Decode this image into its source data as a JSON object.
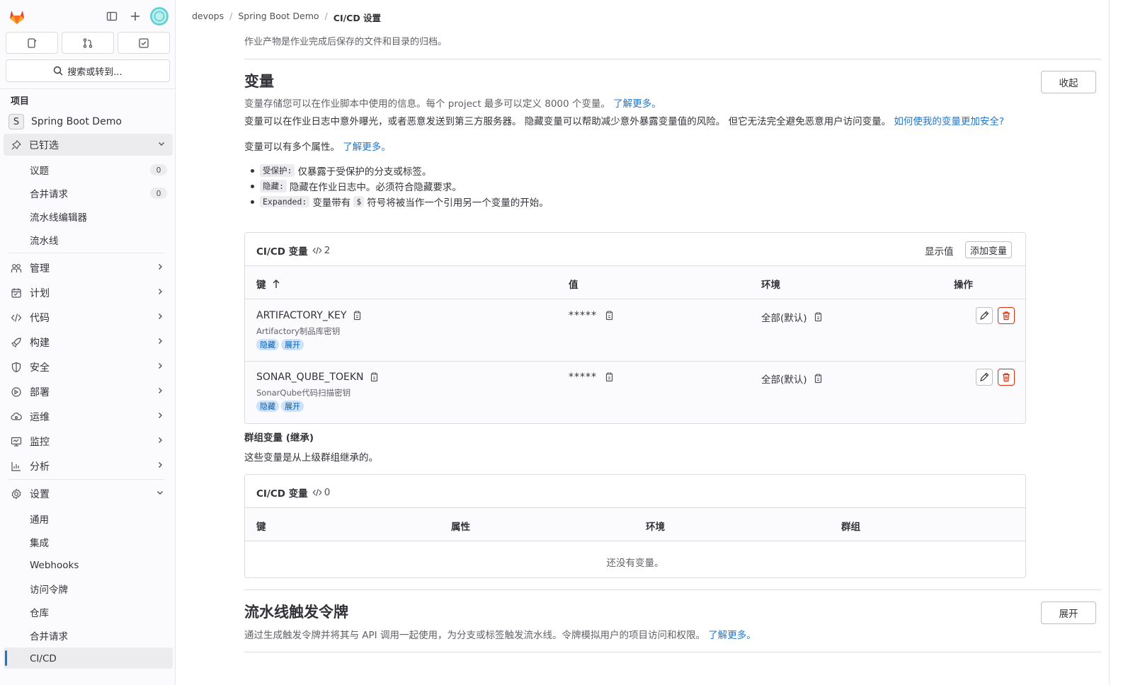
{
  "sidebar": {
    "search_label": "搜索或转到...",
    "section_title": "项目",
    "project_initial": "S",
    "project_name": "Spring Boot Demo",
    "pinned_label": "已钉选",
    "pinned_items": [
      {
        "label": "议题",
        "count": "0"
      },
      {
        "label": "合并请求",
        "count": "0"
      },
      {
        "label": "流水线编辑器"
      },
      {
        "label": "流水线"
      }
    ],
    "nav": [
      {
        "label": "管理",
        "icon": "users-icon"
      },
      {
        "label": "计划",
        "icon": "calendar-icon"
      },
      {
        "label": "代码",
        "icon": "code-icon"
      },
      {
        "label": "构建",
        "icon": "rocket-icon"
      },
      {
        "label": "安全",
        "icon": "shield-icon"
      },
      {
        "label": "部署",
        "icon": "deploy-icon"
      },
      {
        "label": "运维",
        "icon": "cloud-icon"
      },
      {
        "label": "监控",
        "icon": "monitor-icon"
      },
      {
        "label": "分析",
        "icon": "chart-icon"
      }
    ],
    "settings_label": "设置",
    "settings_items": [
      "通用",
      "集成",
      "Webhooks",
      "访问令牌",
      "仓库",
      "合并请求",
      "CI/CD"
    ]
  },
  "breadcrumb": [
    "devops",
    "Spring Boot Demo",
    "CI/CD 设置"
  ],
  "main": {
    "artifacts_desc": "作业产物是作业完成后保存的文件和目录的归档。",
    "variables_title": "变量",
    "collapse_label": "收起",
    "variables_desc": "变量存储您可以在作业脚本中使用的信息。每个 project 最多可以定义 8000 个变量。",
    "learn_more": "了解更多。",
    "exposure_text": "变量可以在作业日志中意外曝光，或者恶意发送到第三方服务器。 隐藏变量可以帮助减少意外暴露变量值的风险。 但它无法完全避免恶意用户访问变量。",
    "exposure_link": "如何使我的变量更加安全?",
    "attrs_text": "变量可以有多个属性。",
    "bullets": [
      {
        "code": "受保护:",
        "text": "仅暴露于受保护的分支或标签。"
      },
      {
        "code": "隐藏:",
        "text": "隐藏在作业日志中。必须符合隐藏要求。"
      },
      {
        "code": "Expanded:",
        "text": "变量带有",
        "code2": "$",
        "text2": "符号将被当作一个引用另一个变量的开始。"
      }
    ],
    "cicd_card": {
      "title": "CI/CD 变量",
      "count": "2",
      "reveal_label": "显示值",
      "add_label": "添加变量",
      "headers": {
        "key": "键",
        "value": "值",
        "env": "环境",
        "actions": "操作"
      },
      "rows": [
        {
          "key": "ARTIFACTORY_KEY",
          "desc": "Artifactory制品库密钥",
          "value": "*****",
          "env": "全部(默认)",
          "badges": [
            "隐藏",
            "展开"
          ]
        },
        {
          "key": "SONAR_QUBE_TOEKN",
          "desc": "SonarQube代码扫描密钥",
          "value": "*****",
          "env": "全部(默认)",
          "badges": [
            "隐藏",
            "展开"
          ]
        }
      ]
    },
    "group_vars_title": "群组变量 (继承)",
    "group_vars_desc": "这些变量是从上级群组继承的。",
    "group_card": {
      "title": "CI/CD 变量",
      "count": "0",
      "headers": {
        "key": "键",
        "attrs": "属性",
        "env": "环境",
        "group": "群组"
      },
      "empty": "还没有变量。"
    },
    "trigger_title": "流水线触发令牌",
    "expand_label": "展开",
    "trigger_desc": "通过生成触发令牌并将其与 API 调用一起使用，为分支或标签触发流水线。令牌模拟用户的项目访问和权限。",
    "trigger_link": "了解更多。"
  }
}
